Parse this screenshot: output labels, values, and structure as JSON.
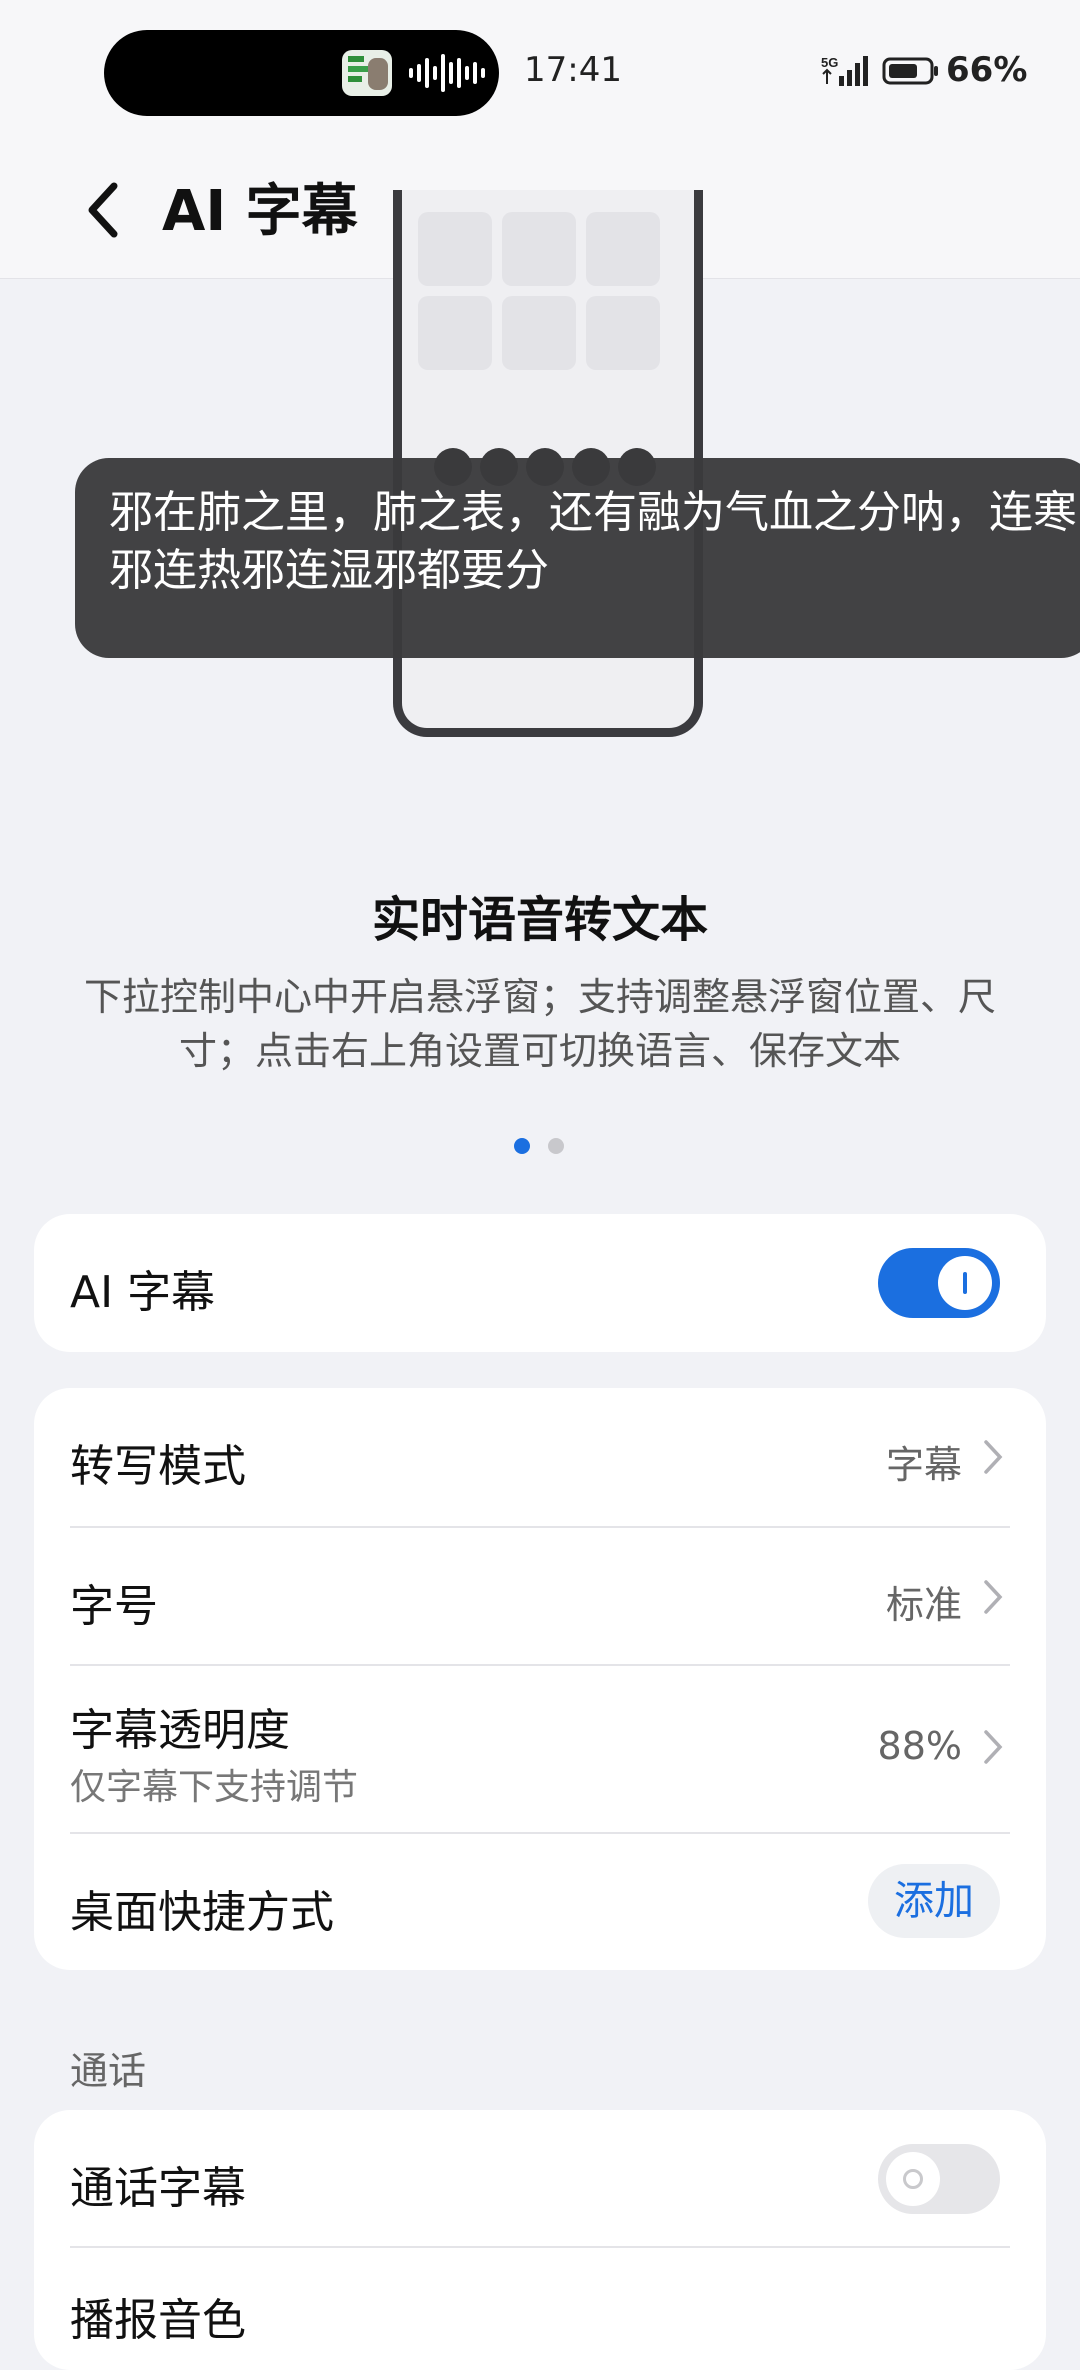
{
  "status_bar": {
    "time": "17:41",
    "network": "5G",
    "battery": "66%",
    "icons": [
      "media-thumbnail-icon",
      "audio-wave-icon",
      "signal-icon",
      "battery-icon"
    ]
  },
  "header": {
    "back_icon": "chevron-left-icon",
    "title": "AI 字幕"
  },
  "preview": {
    "subtitle_text": "邪在肺之里，肺之表，还有融为气血之分呐，连寒邪连热邪连湿邪都要分"
  },
  "feature": {
    "title": "实时语音转文本",
    "description": "下拉控制中心中开启悬浮窗；支持调整悬浮窗位置、尺寸；点击右上角设置可切换语言、保存文本",
    "page_count": 2,
    "active_page": 1
  },
  "main_toggle": {
    "label": "AI 字幕",
    "on": true
  },
  "settings": {
    "mode": {
      "label": "转写模式",
      "value": "字幕"
    },
    "font_size": {
      "label": "字号",
      "value": "标准"
    },
    "opacity": {
      "label": "字幕透明度",
      "sub": "仅字幕下支持调节",
      "value": "88%"
    },
    "shortcut": {
      "label": "桌面快捷方式",
      "button": "添加"
    }
  },
  "call_section": {
    "title": "通话",
    "call_caption": {
      "label": "通话字幕",
      "on": false
    },
    "voice": {
      "label": "播报音色"
    }
  },
  "colors": {
    "accent": "#1b6fe0",
    "toggle_on": "#1b6fe0",
    "toggle_off": "#e6e6e9",
    "background": "#f1f2f6"
  }
}
